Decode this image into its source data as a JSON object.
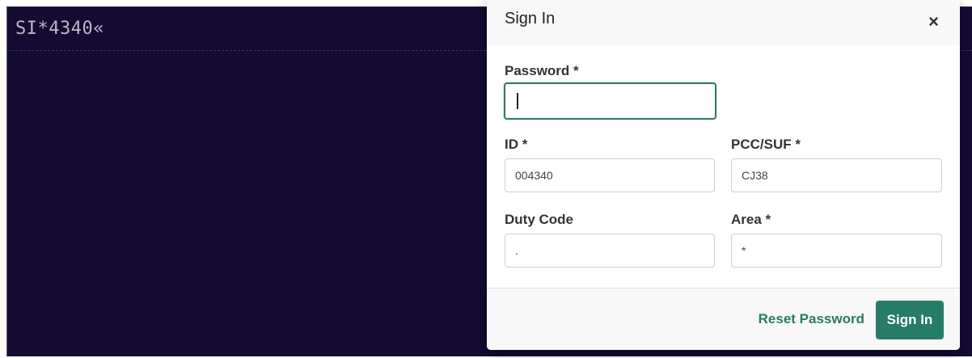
{
  "terminal": {
    "text": "SI*4340«"
  },
  "modal": {
    "title": "Sign In",
    "close_glyph": "×",
    "fields": {
      "password": {
        "label": "Password *",
        "value": ""
      },
      "id": {
        "label": "ID *",
        "value": "004340"
      },
      "pcc": {
        "label": "PCC/SUF *",
        "value": "CJ38"
      },
      "duty": {
        "label": "Duty Code",
        "value": "."
      },
      "area": {
        "label": "Area *",
        "value": "*"
      }
    },
    "footer": {
      "reset_label": "Reset Password",
      "signin_label": "Sign In"
    }
  },
  "colors": {
    "terminal_bg": "#140a32",
    "accent": "#267c66",
    "focus_border": "#2e7d5b"
  }
}
